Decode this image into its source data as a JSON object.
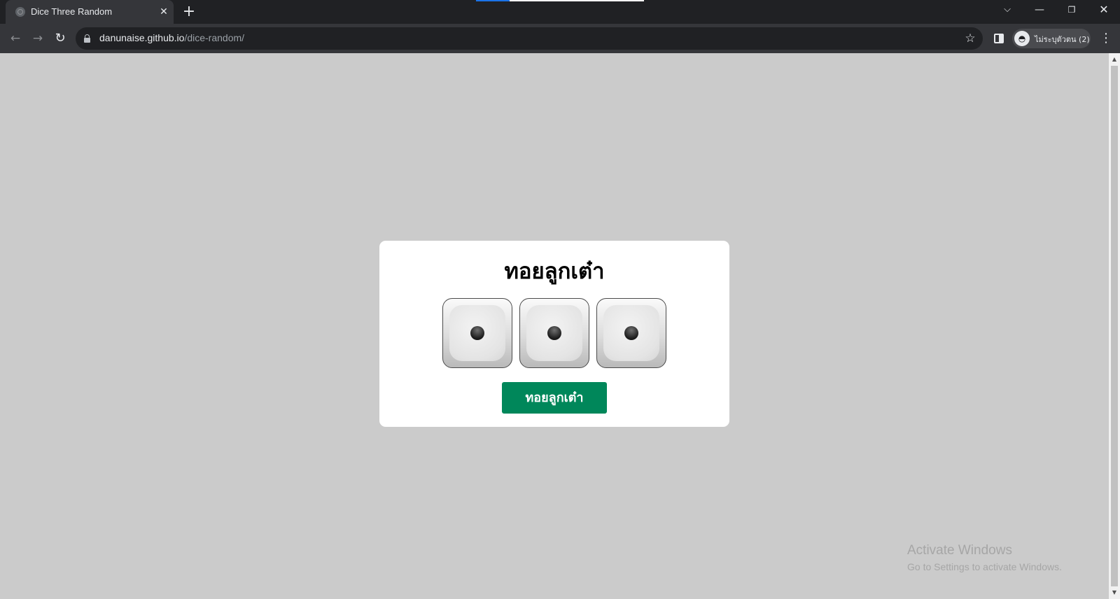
{
  "browser": {
    "tab_title": "Dice Three Random",
    "url_host": "danunaise.github.io",
    "url_path": "/dice-random/",
    "profile_label": "ไม่ระบุตัวตน (2)"
  },
  "icons": {
    "back": "back-arrow-icon",
    "forward": "forward-arrow-icon",
    "reload": "reload-icon",
    "secure": "lock-icon",
    "bookmark": "star-icon",
    "side_panel": "side-panel-icon",
    "profile": "incognito-icon",
    "menu": "kebab-menu-icon"
  },
  "page": {
    "title": "ทอยลูกเต๋า",
    "dice": [
      {
        "value": 1
      },
      {
        "value": 1
      },
      {
        "value": 1
      }
    ],
    "roll_button_label": "ทอยลูกเต๋า",
    "accent_color": "#00875a",
    "background_color": "#cbcbcb"
  },
  "watermark": {
    "title": "Activate Windows",
    "subtitle": "Go to Settings to activate Windows."
  }
}
